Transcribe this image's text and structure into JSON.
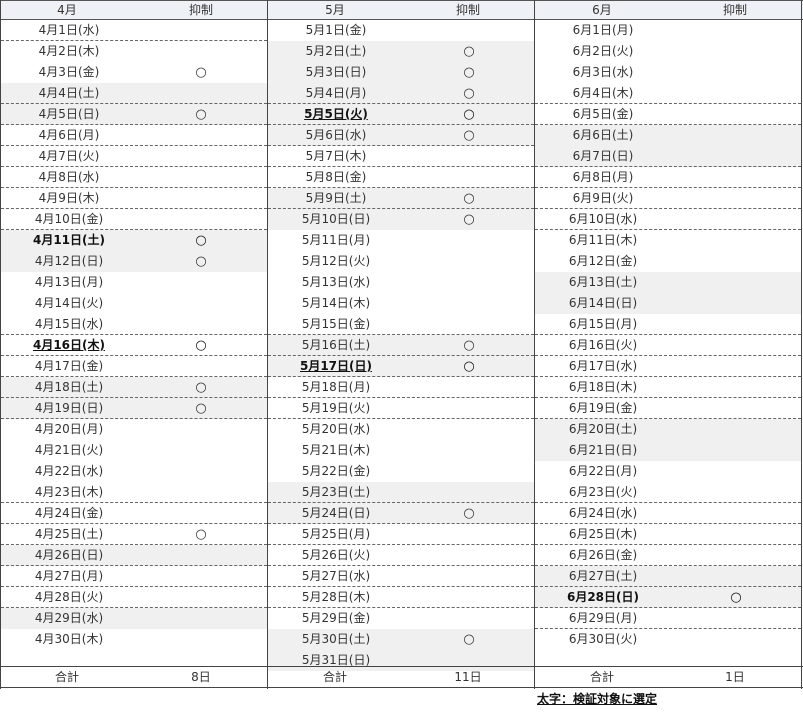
{
  "columns": [
    {
      "month": "4月",
      "mark_header": "抑制",
      "total_label": "合計",
      "total_value": "8日",
      "rows": [
        {
          "d": "4月1日(水)",
          "m": "",
          "s": 0,
          "b": 0,
          "u": 0,
          "dash": 1
        },
        {
          "d": "4月2日(木)",
          "m": "",
          "s": 0,
          "b": 0,
          "u": 0,
          "dash": 0
        },
        {
          "d": "4月3日(金)",
          "m": "○",
          "s": 0,
          "b": 0,
          "u": 0,
          "dash": 0
        },
        {
          "d": "4月4日(土)",
          "m": "",
          "s": 1,
          "b": 0,
          "u": 0,
          "dash": 1
        },
        {
          "d": "4月5日(日)",
          "m": "○",
          "s": 1,
          "b": 0,
          "u": 0,
          "dash": 1
        },
        {
          "d": "4月6日(月)",
          "m": "",
          "s": 0,
          "b": 0,
          "u": 0,
          "dash": 1
        },
        {
          "d": "4月7日(火)",
          "m": "",
          "s": 0,
          "b": 0,
          "u": 0,
          "dash": 1
        },
        {
          "d": "4月8日(水)",
          "m": "",
          "s": 0,
          "b": 0,
          "u": 0,
          "dash": 1
        },
        {
          "d": "4月9日(木)",
          "m": "",
          "s": 0,
          "b": 0,
          "u": 0,
          "dash": 1
        },
        {
          "d": "4月10日(金)",
          "m": "",
          "s": 0,
          "b": 0,
          "u": 0,
          "dash": 1
        },
        {
          "d": "4月11日(土)",
          "m": "○",
          "s": 1,
          "b": 1,
          "u": 0,
          "dash": 0
        },
        {
          "d": "4月12日(日)",
          "m": "○",
          "s": 1,
          "b": 0,
          "u": 0,
          "dash": 0
        },
        {
          "d": "4月13日(月)",
          "m": "",
          "s": 0,
          "b": 0,
          "u": 0,
          "dash": 0
        },
        {
          "d": "4月14日(火)",
          "m": "",
          "s": 0,
          "b": 0,
          "u": 0,
          "dash": 0
        },
        {
          "d": "4月15日(水)",
          "m": "",
          "s": 0,
          "b": 0,
          "u": 0,
          "dash": 1
        },
        {
          "d": "4月16日(木)",
          "m": "○",
          "s": 0,
          "b": 1,
          "u": 1,
          "dash": 1
        },
        {
          "d": "4月17日(金)",
          "m": "",
          "s": 0,
          "b": 0,
          "u": 0,
          "dash": 1
        },
        {
          "d": "4月18日(土)",
          "m": "○",
          "s": 1,
          "b": 0,
          "u": 0,
          "dash": 1
        },
        {
          "d": "4月19日(日)",
          "m": "○",
          "s": 1,
          "b": 0,
          "u": 0,
          "dash": 1
        },
        {
          "d": "4月20日(月)",
          "m": "",
          "s": 0,
          "b": 0,
          "u": 0,
          "dash": 0
        },
        {
          "d": "4月21日(火)",
          "m": "",
          "s": 0,
          "b": 0,
          "u": 0,
          "dash": 0
        },
        {
          "d": "4月22日(水)",
          "m": "",
          "s": 0,
          "b": 0,
          "u": 0,
          "dash": 0
        },
        {
          "d": "4月23日(木)",
          "m": "",
          "s": 0,
          "b": 0,
          "u": 0,
          "dash": 1
        },
        {
          "d": "4月24日(金)",
          "m": "",
          "s": 0,
          "b": 0,
          "u": 0,
          "dash": 1
        },
        {
          "d": "4月25日(土)",
          "m": "○",
          "s": 0,
          "b": 0,
          "u": 0,
          "dash": 1
        },
        {
          "d": "4月26日(日)",
          "m": "",
          "s": 1,
          "b": 0,
          "u": 0,
          "dash": 1
        },
        {
          "d": "4月27日(月)",
          "m": "",
          "s": 0,
          "b": 0,
          "u": 0,
          "dash": 1
        },
        {
          "d": "4月28日(火)",
          "m": "",
          "s": 0,
          "b": 0,
          "u": 0,
          "dash": 1
        },
        {
          "d": "4月29日(水)",
          "m": "",
          "s": 1,
          "b": 0,
          "u": 0,
          "dash": 0
        },
        {
          "d": "4月30日(木)",
          "m": "",
          "s": 0,
          "b": 0,
          "u": 0,
          "dash": 0
        }
      ]
    },
    {
      "month": "5月",
      "mark_header": "抑制",
      "total_label": "合計",
      "total_value": "11日",
      "rows": [
        {
          "d": "5月1日(金)",
          "m": "",
          "s": 0,
          "b": 0,
          "u": 0,
          "dash": 0
        },
        {
          "d": "5月2日(土)",
          "m": "○",
          "s": 1,
          "b": 0,
          "u": 0,
          "dash": 0
        },
        {
          "d": "5月3日(日)",
          "m": "○",
          "s": 1,
          "b": 0,
          "u": 0,
          "dash": 0
        },
        {
          "d": "5月4日(月)",
          "m": "○",
          "s": 1,
          "b": 0,
          "u": 0,
          "dash": 1
        },
        {
          "d": "5月5日(火)",
          "m": "○",
          "s": 1,
          "b": 1,
          "u": 1,
          "dash": 1
        },
        {
          "d": "5月6日(水)",
          "m": "○",
          "s": 1,
          "b": 0,
          "u": 0,
          "dash": 1
        },
        {
          "d": "5月7日(木)",
          "m": "",
          "s": 0,
          "b": 0,
          "u": 0,
          "dash": 1
        },
        {
          "d": "5月8日(金)",
          "m": "",
          "s": 0,
          "b": 0,
          "u": 0,
          "dash": 1
        },
        {
          "d": "5月9日(土)",
          "m": "○",
          "s": 1,
          "b": 0,
          "u": 0,
          "dash": 1
        },
        {
          "d": "5月10日(日)",
          "m": "○",
          "s": 1,
          "b": 0,
          "u": 0,
          "dash": 0
        },
        {
          "d": "5月11日(月)",
          "m": "",
          "s": 0,
          "b": 0,
          "u": 0,
          "dash": 0
        },
        {
          "d": "5月12日(火)",
          "m": "",
          "s": 0,
          "b": 0,
          "u": 0,
          "dash": 0
        },
        {
          "d": "5月13日(水)",
          "m": "",
          "s": 0,
          "b": 0,
          "u": 0,
          "dash": 0
        },
        {
          "d": "5月14日(木)",
          "m": "",
          "s": 0,
          "b": 0,
          "u": 0,
          "dash": 0
        },
        {
          "d": "5月15日(金)",
          "m": "",
          "s": 0,
          "b": 0,
          "u": 0,
          "dash": 1
        },
        {
          "d": "5月16日(土)",
          "m": "○",
          "s": 1,
          "b": 0,
          "u": 0,
          "dash": 1
        },
        {
          "d": "5月17日(日)",
          "m": "○",
          "s": 1,
          "b": 1,
          "u": 1,
          "dash": 1
        },
        {
          "d": "5月18日(月)",
          "m": "",
          "s": 0,
          "b": 0,
          "u": 0,
          "dash": 1
        },
        {
          "d": "5月19日(火)",
          "m": "",
          "s": 0,
          "b": 0,
          "u": 0,
          "dash": 1
        },
        {
          "d": "5月20日(水)",
          "m": "",
          "s": 0,
          "b": 0,
          "u": 0,
          "dash": 0
        },
        {
          "d": "5月21日(木)",
          "m": "",
          "s": 0,
          "b": 0,
          "u": 0,
          "dash": 0
        },
        {
          "d": "5月22日(金)",
          "m": "",
          "s": 0,
          "b": 0,
          "u": 0,
          "dash": 0
        },
        {
          "d": "5月23日(土)",
          "m": "",
          "s": 1,
          "b": 0,
          "u": 0,
          "dash": 1
        },
        {
          "d": "5月24日(日)",
          "m": "○",
          "s": 1,
          "b": 0,
          "u": 0,
          "dash": 1
        },
        {
          "d": "5月25日(月)",
          "m": "",
          "s": 0,
          "b": 0,
          "u": 0,
          "dash": 1
        },
        {
          "d": "5月26日(火)",
          "m": "",
          "s": 0,
          "b": 0,
          "u": 0,
          "dash": 1
        },
        {
          "d": "5月27日(水)",
          "m": "",
          "s": 0,
          "b": 0,
          "u": 0,
          "dash": 1
        },
        {
          "d": "5月28日(木)",
          "m": "",
          "s": 0,
          "b": 0,
          "u": 0,
          "dash": 1
        },
        {
          "d": "5月29日(金)",
          "m": "",
          "s": 0,
          "b": 0,
          "u": 0,
          "dash": 0
        },
        {
          "d": "5月30日(土)",
          "m": "○",
          "s": 1,
          "b": 0,
          "u": 0,
          "dash": 0
        },
        {
          "d": "5月31日(日)",
          "m": "",
          "s": 1,
          "b": 0,
          "u": 0,
          "dash": 0
        }
      ]
    },
    {
      "month": "6月",
      "mark_header": "抑制",
      "total_label": "合計",
      "total_value": "1日",
      "rows": [
        {
          "d": "6月1日(月)",
          "m": "",
          "s": 0,
          "b": 0,
          "u": 0,
          "dash": 0
        },
        {
          "d": "6月2日(火)",
          "m": "",
          "s": 0,
          "b": 0,
          "u": 0,
          "dash": 0
        },
        {
          "d": "6月3日(水)",
          "m": "",
          "s": 0,
          "b": 0,
          "u": 0,
          "dash": 0
        },
        {
          "d": "6月4日(木)",
          "m": "",
          "s": 0,
          "b": 0,
          "u": 0,
          "dash": 1
        },
        {
          "d": "6月5日(金)",
          "m": "",
          "s": 0,
          "b": 0,
          "u": 0,
          "dash": 1
        },
        {
          "d": "6月6日(土)",
          "m": "",
          "s": 1,
          "b": 0,
          "u": 0,
          "dash": 0
        },
        {
          "d": "6月7日(日)",
          "m": "",
          "s": 1,
          "b": 0,
          "u": 0,
          "dash": 1
        },
        {
          "d": "6月8日(月)",
          "m": "",
          "s": 0,
          "b": 0,
          "u": 0,
          "dash": 1
        },
        {
          "d": "6月9日(火)",
          "m": "",
          "s": 0,
          "b": 0,
          "u": 0,
          "dash": 1
        },
        {
          "d": "6月10日(水)",
          "m": "",
          "s": 0,
          "b": 0,
          "u": 0,
          "dash": 1
        },
        {
          "d": "6月11日(木)",
          "m": "",
          "s": 0,
          "b": 0,
          "u": 0,
          "dash": 0
        },
        {
          "d": "6月12日(金)",
          "m": "",
          "s": 0,
          "b": 0,
          "u": 0,
          "dash": 0
        },
        {
          "d": "6月13日(土)",
          "m": "",
          "s": 1,
          "b": 0,
          "u": 0,
          "dash": 0
        },
        {
          "d": "6月14日(日)",
          "m": "",
          "s": 1,
          "b": 0,
          "u": 0,
          "dash": 0
        },
        {
          "d": "6月15日(月)",
          "m": "",
          "s": 0,
          "b": 0,
          "u": 0,
          "dash": 1
        },
        {
          "d": "6月16日(火)",
          "m": "",
          "s": 0,
          "b": 0,
          "u": 0,
          "dash": 1
        },
        {
          "d": "6月17日(水)",
          "m": "",
          "s": 0,
          "b": 0,
          "u": 0,
          "dash": 1
        },
        {
          "d": "6月18日(木)",
          "m": "",
          "s": 0,
          "b": 0,
          "u": 0,
          "dash": 1
        },
        {
          "d": "6月19日(金)",
          "m": "",
          "s": 0,
          "b": 0,
          "u": 0,
          "dash": 1
        },
        {
          "d": "6月20日(土)",
          "m": "",
          "s": 1,
          "b": 0,
          "u": 0,
          "dash": 0
        },
        {
          "d": "6月21日(日)",
          "m": "",
          "s": 1,
          "b": 0,
          "u": 0,
          "dash": 0
        },
        {
          "d": "6月22日(月)",
          "m": "",
          "s": 0,
          "b": 0,
          "u": 0,
          "dash": 0
        },
        {
          "d": "6月23日(火)",
          "m": "",
          "s": 0,
          "b": 0,
          "u": 0,
          "dash": 1
        },
        {
          "d": "6月24日(水)",
          "m": "",
          "s": 0,
          "b": 0,
          "u": 0,
          "dash": 1
        },
        {
          "d": "6月25日(木)",
          "m": "",
          "s": 0,
          "b": 0,
          "u": 0,
          "dash": 1
        },
        {
          "d": "6月26日(金)",
          "m": "",
          "s": 0,
          "b": 0,
          "u": 0,
          "dash": 1
        },
        {
          "d": "6月27日(土)",
          "m": "",
          "s": 1,
          "b": 0,
          "u": 0,
          "dash": 1
        },
        {
          "d": "6月28日(日)",
          "m": "○",
          "s": 1,
          "b": 1,
          "u": 0,
          "dash": 1
        },
        {
          "d": "6月29日(月)",
          "m": "",
          "s": 0,
          "b": 0,
          "u": 0,
          "dash": 1
        },
        {
          "d": "6月30日(火)",
          "m": "",
          "s": 0,
          "b": 0,
          "u": 0,
          "dash": 0
        }
      ]
    }
  ],
  "note": "太字：検証対象に選定"
}
